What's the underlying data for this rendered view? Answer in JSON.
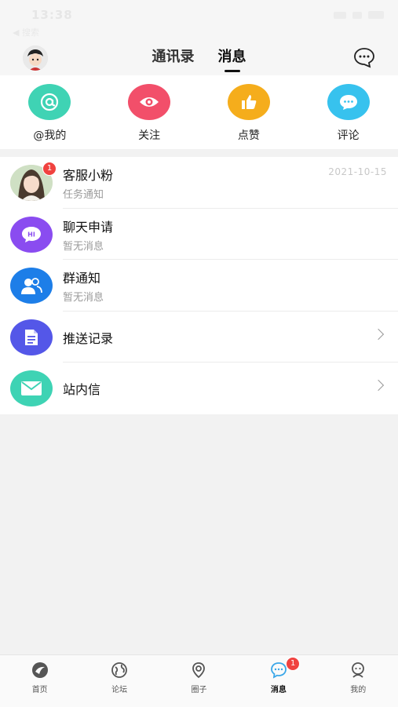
{
  "status_bar": {
    "time": "13:38",
    "back_label": "◀ 搜索"
  },
  "header": {
    "tabs": [
      {
        "label": "通讯录"
      },
      {
        "label": "消息"
      }
    ]
  },
  "quick_actions": [
    {
      "label": "@我的",
      "icon": "at-icon",
      "color": "#3fd3b4"
    },
    {
      "label": "关注",
      "icon": "eye-icon",
      "color": "#f24f6a"
    },
    {
      "label": "点赞",
      "icon": "thumbs-up-icon",
      "color": "#f5ad1c"
    },
    {
      "label": "评论",
      "icon": "comment-icon",
      "color": "#37c2ee"
    }
  ],
  "messages": [
    {
      "title": "客服小粉",
      "subtitle": "任务通知",
      "date": "2021-10-15",
      "badge": "1"
    },
    {
      "title": "聊天申请",
      "subtitle": "暂无消息",
      "icon": "hi-chat-icon",
      "color": "#8a4cf0"
    },
    {
      "title": "群通知",
      "subtitle": "暂无消息",
      "icon": "group-icon",
      "color": "#1d7ee8"
    },
    {
      "title": "推送记录",
      "icon": "document-icon",
      "color": "#5457e8"
    },
    {
      "title": "站内信",
      "icon": "mail-icon",
      "color": "#3ed3b4"
    }
  ],
  "tabbar": {
    "items": [
      {
        "label": "首页"
      },
      {
        "label": "论坛"
      },
      {
        "label": "圈子"
      },
      {
        "label": "消息",
        "badge": "1"
      },
      {
        "label": "我的"
      }
    ],
    "active_color": "#3aa7e8"
  }
}
